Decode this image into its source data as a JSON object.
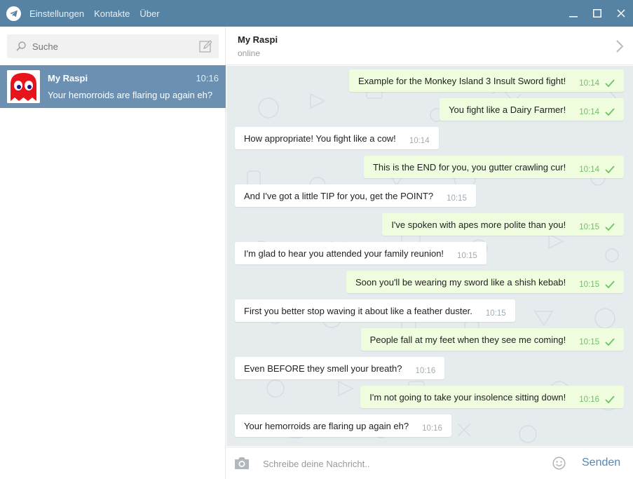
{
  "menu": {
    "items": [
      "Einstellungen",
      "Kontakte",
      "Über"
    ]
  },
  "search": {
    "placeholder": "Suche"
  },
  "dialogs": [
    {
      "name": "My Raspi",
      "time": "10:16",
      "preview": "Your hemorroids are flaring up again eh?"
    }
  ],
  "chat": {
    "peer_name": "My Raspi",
    "peer_status": "online",
    "messages": [
      {
        "dir": "out",
        "text": "Example for the Monkey Island 3 Insult Sword fight!",
        "time": "10:14"
      },
      {
        "dir": "out",
        "text": "You fight like a Dairy Farmer!",
        "time": "10:14"
      },
      {
        "dir": "in",
        "text": "How appropriate! You fight like a cow!",
        "time": "10:14"
      },
      {
        "dir": "out",
        "text": "This is the END for you, you gutter crawling cur!",
        "time": "10:14"
      },
      {
        "dir": "in",
        "text": "And I've got a little TIP for you, get the POINT?",
        "time": "10:15"
      },
      {
        "dir": "out",
        "text": "I've spoken with apes more polite than you!",
        "time": "10:15"
      },
      {
        "dir": "in",
        "text": "I'm glad to hear you attended your family reunion!",
        "time": "10:15"
      },
      {
        "dir": "out",
        "text": "Soon you'll be wearing my sword like a shish kebab!",
        "time": "10:15"
      },
      {
        "dir": "in",
        "text": "First you better stop waving it about like a feather duster.",
        "time": "10:15"
      },
      {
        "dir": "out",
        "text": "People fall at my feet when they see me coming!",
        "time": "10:15"
      },
      {
        "dir": "in",
        "text": "Even BEFORE they smell your breath?",
        "time": "10:16"
      },
      {
        "dir": "out",
        "text": "I'm not going to take your insolence sitting down!",
        "time": "10:16"
      },
      {
        "dir": "in",
        "text": "Your hemorroids are flaring up again eh?",
        "time": "10:16"
      }
    ]
  },
  "composer": {
    "placeholder": "Schreibe deine Nachricht..",
    "send_label": "Senden"
  },
  "colors": {
    "titlebar": "#5682a3",
    "selected_dialog": "#6b90b1",
    "outgoing_bubble": "#effdde",
    "check": "#6cc264",
    "send": "#5488b6"
  },
  "icons": {
    "app": "telegram-icon",
    "search": "search-icon",
    "compose": "compose-icon",
    "minimize": "minimize-icon",
    "maximize": "maximize-icon",
    "close": "close-icon",
    "chevron": "chevron-right-icon",
    "camera": "camera-icon",
    "emoji": "emoji-icon",
    "read": "check-icon"
  }
}
